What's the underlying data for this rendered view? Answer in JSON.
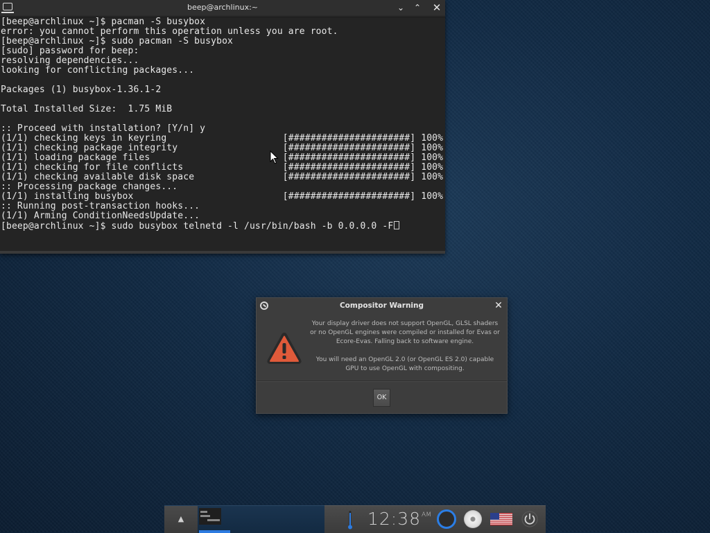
{
  "terminal": {
    "title": "beep@archlinux:~",
    "minimize_glyph": "⌄",
    "maximize_glyph": "⌃",
    "close_glyph": "✕",
    "lines": [
      "[beep@archlinux ~]$ pacman -S busybox",
      "error: you cannot perform this operation unless you are root.",
      "[beep@archlinux ~]$ sudo pacman -S busybox",
      "[sudo] password for beep:",
      "resolving dependencies...",
      "looking for conflicting packages...",
      "",
      "Packages (1) busybox-1.36.1-2",
      "",
      "Total Installed Size:  1.75 MiB",
      "",
      ":: Proceed with installation? [Y/n] y",
      "(1/1) checking keys in keyring                     [######################] 100%",
      "(1/1) checking package integrity                   [######################] 100%",
      "(1/1) loading package files                        [######################] 100%",
      "(1/1) checking for file conflicts                  [######################] 100%",
      "(1/1) checking available disk space                [######################] 100%",
      ":: Processing package changes...",
      "(1/1) installing busybox                           [######################] 100%",
      ":: Running post-transaction hooks...",
      "(1/1) Arming ConditionNeedsUpdate...",
      "[beep@archlinux ~]$ sudo busybox telnetd -l /usr/bin/bash -b 0.0.0.0 -F"
    ]
  },
  "dialog": {
    "title": "Compositor Warning",
    "close_glyph": "✕",
    "message_1": "Your display driver does not support OpenGL, GLSL shaders or no OpenGL engines were compiled or installed for Evas or Ecore-Evas. Falling back to software engine.",
    "message_2": "You will need an OpenGL 2.0 (or OpenGL ES 2.0) capable GPU to use OpenGL with compositing.",
    "ok_label": "OK",
    "icon": "warning-triangle-icon"
  },
  "taskbar": {
    "up_glyph": "▲",
    "clock_time": "12:38",
    "clock_ampm": "AM",
    "icons": [
      "thermometer-icon",
      "ring-icon",
      "disc-icon",
      "us-flag-icon",
      "power-icon"
    ],
    "accent_color": "#2c7be0"
  }
}
